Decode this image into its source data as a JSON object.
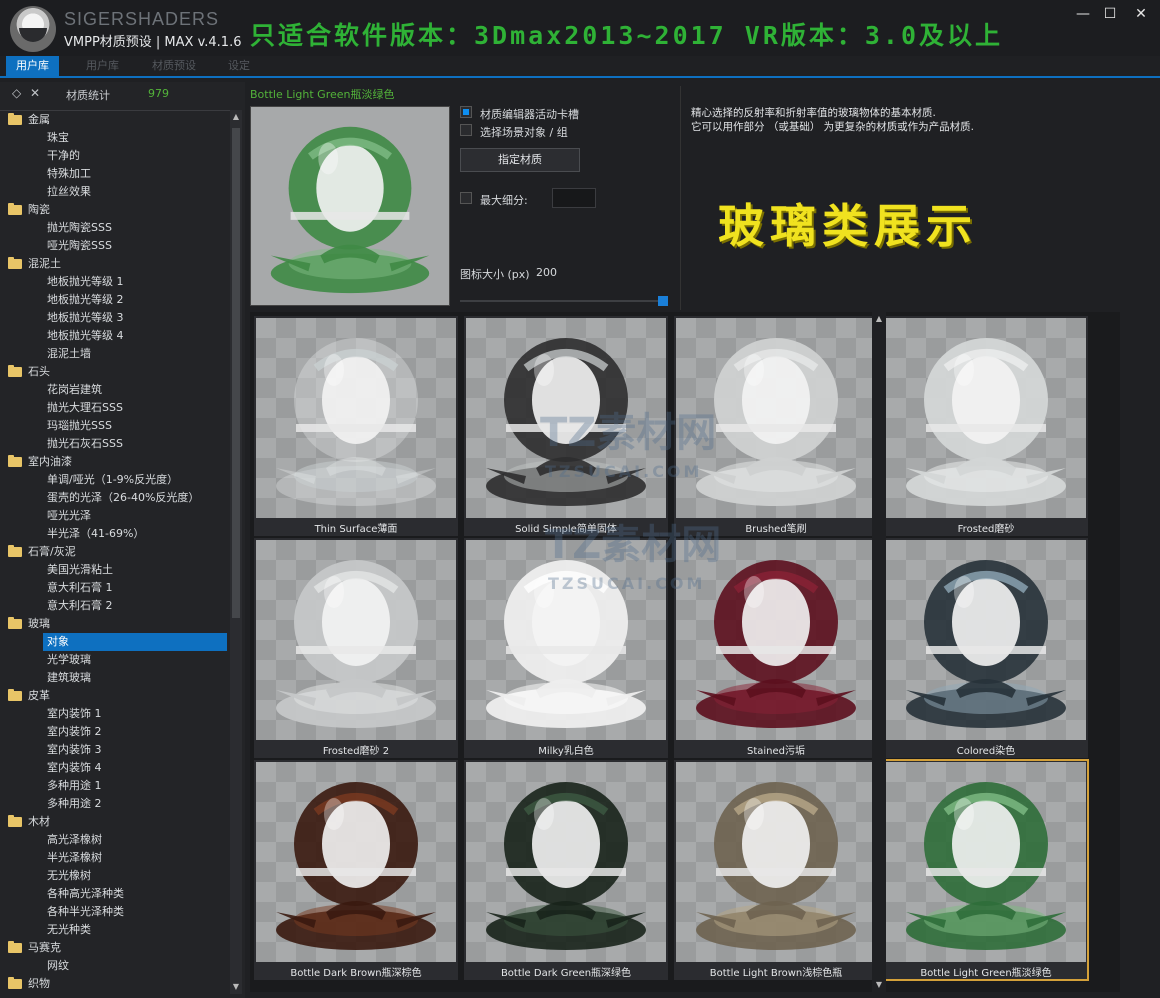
{
  "titlebar": {
    "brand": "SIGERSHADERS",
    "version": "VMPP材质预设 | MAX v.4.1.6",
    "banner": "只适合软件版本：3Dmax2013~2017  VR版本：3.0及以上",
    "minimize": "—",
    "maximize": "☐",
    "close": "✕"
  },
  "tabs": [
    {
      "label": "用户库",
      "active": true
    },
    {
      "label": "用户库",
      "active": false
    },
    {
      "label": "材质预设",
      "active": false
    },
    {
      "label": "设定",
      "active": false
    }
  ],
  "left_panel": {
    "pin_icon": "◇",
    "close_icon": "✕",
    "label": "材质统计",
    "count": "979",
    "tree": [
      {
        "type": "cat",
        "label": "金属"
      },
      {
        "type": "item",
        "label": "珠宝"
      },
      {
        "type": "item",
        "label": "干净的"
      },
      {
        "type": "item",
        "label": "特殊加工"
      },
      {
        "type": "item",
        "label": "拉丝效果"
      },
      {
        "type": "cat",
        "label": "陶瓷"
      },
      {
        "type": "item",
        "label": "抛光陶瓷SSS"
      },
      {
        "type": "item",
        "label": "哑光陶瓷SSS"
      },
      {
        "type": "cat",
        "label": "混泥土"
      },
      {
        "type": "item",
        "label": "地板抛光等级 1"
      },
      {
        "type": "item",
        "label": "地板抛光等级 2"
      },
      {
        "type": "item",
        "label": "地板抛光等级 3"
      },
      {
        "type": "item",
        "label": "地板抛光等级 4"
      },
      {
        "type": "item",
        "label": "混泥土墙"
      },
      {
        "type": "cat",
        "label": "石头"
      },
      {
        "type": "item",
        "label": "花岗岩建筑"
      },
      {
        "type": "item",
        "label": "抛光大理石SSS"
      },
      {
        "type": "item",
        "label": "玛瑙抛光SSS"
      },
      {
        "type": "item",
        "label": "抛光石灰石SSS"
      },
      {
        "type": "cat",
        "label": "室内油漆"
      },
      {
        "type": "item",
        "label": "单调/哑光（1-9%反光度）"
      },
      {
        "type": "item",
        "label": "蛋壳的光泽（26-40%反光度）"
      },
      {
        "type": "item",
        "label": "哑光光泽"
      },
      {
        "type": "item",
        "label": "半光泽（41-69%）"
      },
      {
        "type": "cat",
        "label": "石膏/灰泥"
      },
      {
        "type": "item",
        "label": "美国光滑粘土"
      },
      {
        "type": "item",
        "label": "意大利石膏 1"
      },
      {
        "type": "item",
        "label": "意大利石膏 2"
      },
      {
        "type": "cat",
        "label": "玻璃"
      },
      {
        "type": "item",
        "label": "对象",
        "selected": true
      },
      {
        "type": "item",
        "label": "光学玻璃"
      },
      {
        "type": "item",
        "label": "建筑玻璃"
      },
      {
        "type": "cat",
        "label": "皮革"
      },
      {
        "type": "item",
        "label": "室内装饰 1"
      },
      {
        "type": "item",
        "label": "室内装饰 2"
      },
      {
        "type": "item",
        "label": "室内装饰 3"
      },
      {
        "type": "item",
        "label": "室内装饰 4"
      },
      {
        "type": "item",
        "label": "多种用途 1"
      },
      {
        "type": "item",
        "label": "多种用途 2"
      },
      {
        "type": "cat",
        "label": "木材"
      },
      {
        "type": "item",
        "label": "高光泽橡树"
      },
      {
        "type": "item",
        "label": "半光泽橡树"
      },
      {
        "type": "item",
        "label": "无光橡树"
      },
      {
        "type": "item",
        "label": "各种高光泽种类"
      },
      {
        "type": "item",
        "label": "各种半光泽种类"
      },
      {
        "type": "item",
        "label": "无光种类"
      },
      {
        "type": "cat",
        "label": "马赛克"
      },
      {
        "type": "item",
        "label": "网纹"
      },
      {
        "type": "cat",
        "label": "织物"
      }
    ]
  },
  "detail": {
    "material_name": "Bottle Light Green瓶淡绿色",
    "opt_editor": "材质编辑器活动卡槽",
    "opt_editor_checked": true,
    "opt_scene": "选择场景对象 / 组",
    "opt_scene_checked": false,
    "assign_button": "指定材质",
    "max_subdiv": "最大细分:",
    "max_subdiv_checked": false,
    "icon_size_label": "图标大小 (px)",
    "icon_size_value": "200",
    "desc_line1": "精心选择的反射率和折射率值的玻璃物体的基本材质.",
    "desc_line2": "它可以用作部分 （或基础） 为更复杂的材质或作为产品材质.",
    "showcase": "玻璃类展示",
    "preview_color": "#3f8a45"
  },
  "materials": [
    {
      "label": "Thin Surface薄面",
      "color": "#e8eaea",
      "tint": "#c9d0d1",
      "style": "clear"
    },
    {
      "label": "Solid Simple简单固体",
      "color": "#2d2e2f",
      "tint": "#bfc3c4",
      "style": "dark-clear"
    },
    {
      "label": "Brushed笔刷",
      "color": "#cfd1d1",
      "tint": "#e6e7e7",
      "style": "frosted"
    },
    {
      "label": "Frosted磨砂",
      "color": "#d3d6d6",
      "tint": "#eceded",
      "style": "frosted"
    },
    {
      "label": "Frosted磨砂 2",
      "color": "#c5c7c8",
      "tint": "#e4e5e5",
      "style": "frosted"
    },
    {
      "label": "Milky乳白色",
      "color": "#eeeeee",
      "tint": "#ffffff",
      "style": "milky"
    },
    {
      "label": "Stained污垢",
      "color": "#5c0f1e",
      "tint": "#8a2236",
      "style": "solid"
    },
    {
      "label": "Colored染色",
      "color": "#27323a",
      "tint": "#8fa7b7",
      "style": "dark-clear"
    },
    {
      "label": "Bottle Dark Brown瓶深棕色",
      "color": "#3a1a10",
      "tint": "#7a3a20",
      "style": "dark-clear"
    },
    {
      "label": "Bottle Dark Green瓶深绿色",
      "color": "#18241b",
      "tint": "#3d5a42",
      "style": "dark-clear"
    },
    {
      "label": "Bottle Light Brown浅棕色瓶",
      "color": "#6e6350",
      "tint": "#b8a888",
      "style": "dark-clear"
    },
    {
      "label": "Bottle Light Green瓶淡绿色",
      "color": "#2f6e3a",
      "tint": "#7fbb84",
      "style": "dark-clear",
      "selected": true
    }
  ],
  "watermark": {
    "text1": "TZ素材网",
    "text2": "TZSUCAI.COM"
  }
}
